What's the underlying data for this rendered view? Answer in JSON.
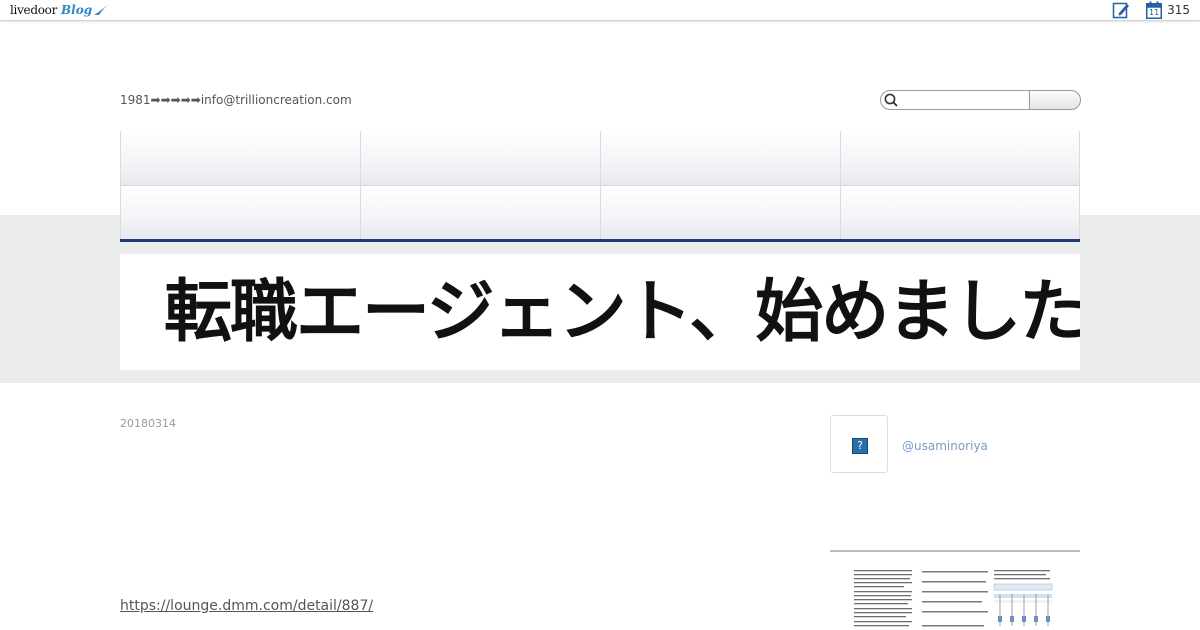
{
  "topbar": {
    "logo_main": "livedoor",
    "logo_blog": "Blog",
    "calendar_day": "11",
    "count": "315",
    "icons": [
      "edit-icon",
      "calendar-icon"
    ]
  },
  "header": {
    "tagline": "1981➡➡➡➡➡info@trillioncreation.com",
    "search": {
      "placeholder": "",
      "icon": "search-icon"
    }
  },
  "nav": {
    "items": [
      "",
      "",
      "",
      "",
      "",
      "",
      "",
      ""
    ]
  },
  "banner": {
    "text": "転職エージェント、始めました"
  },
  "post": {
    "date": "20180314",
    "link": "https://lounge.dmm.com/detail/887/"
  },
  "sidebar": {
    "profile_name": "@usaminoriya",
    "profile_icon_text": "?"
  },
  "colors": {
    "nav_border": "#1f3c7a",
    "band": "#ececec",
    "profile_link": "#7a9cc6"
  }
}
